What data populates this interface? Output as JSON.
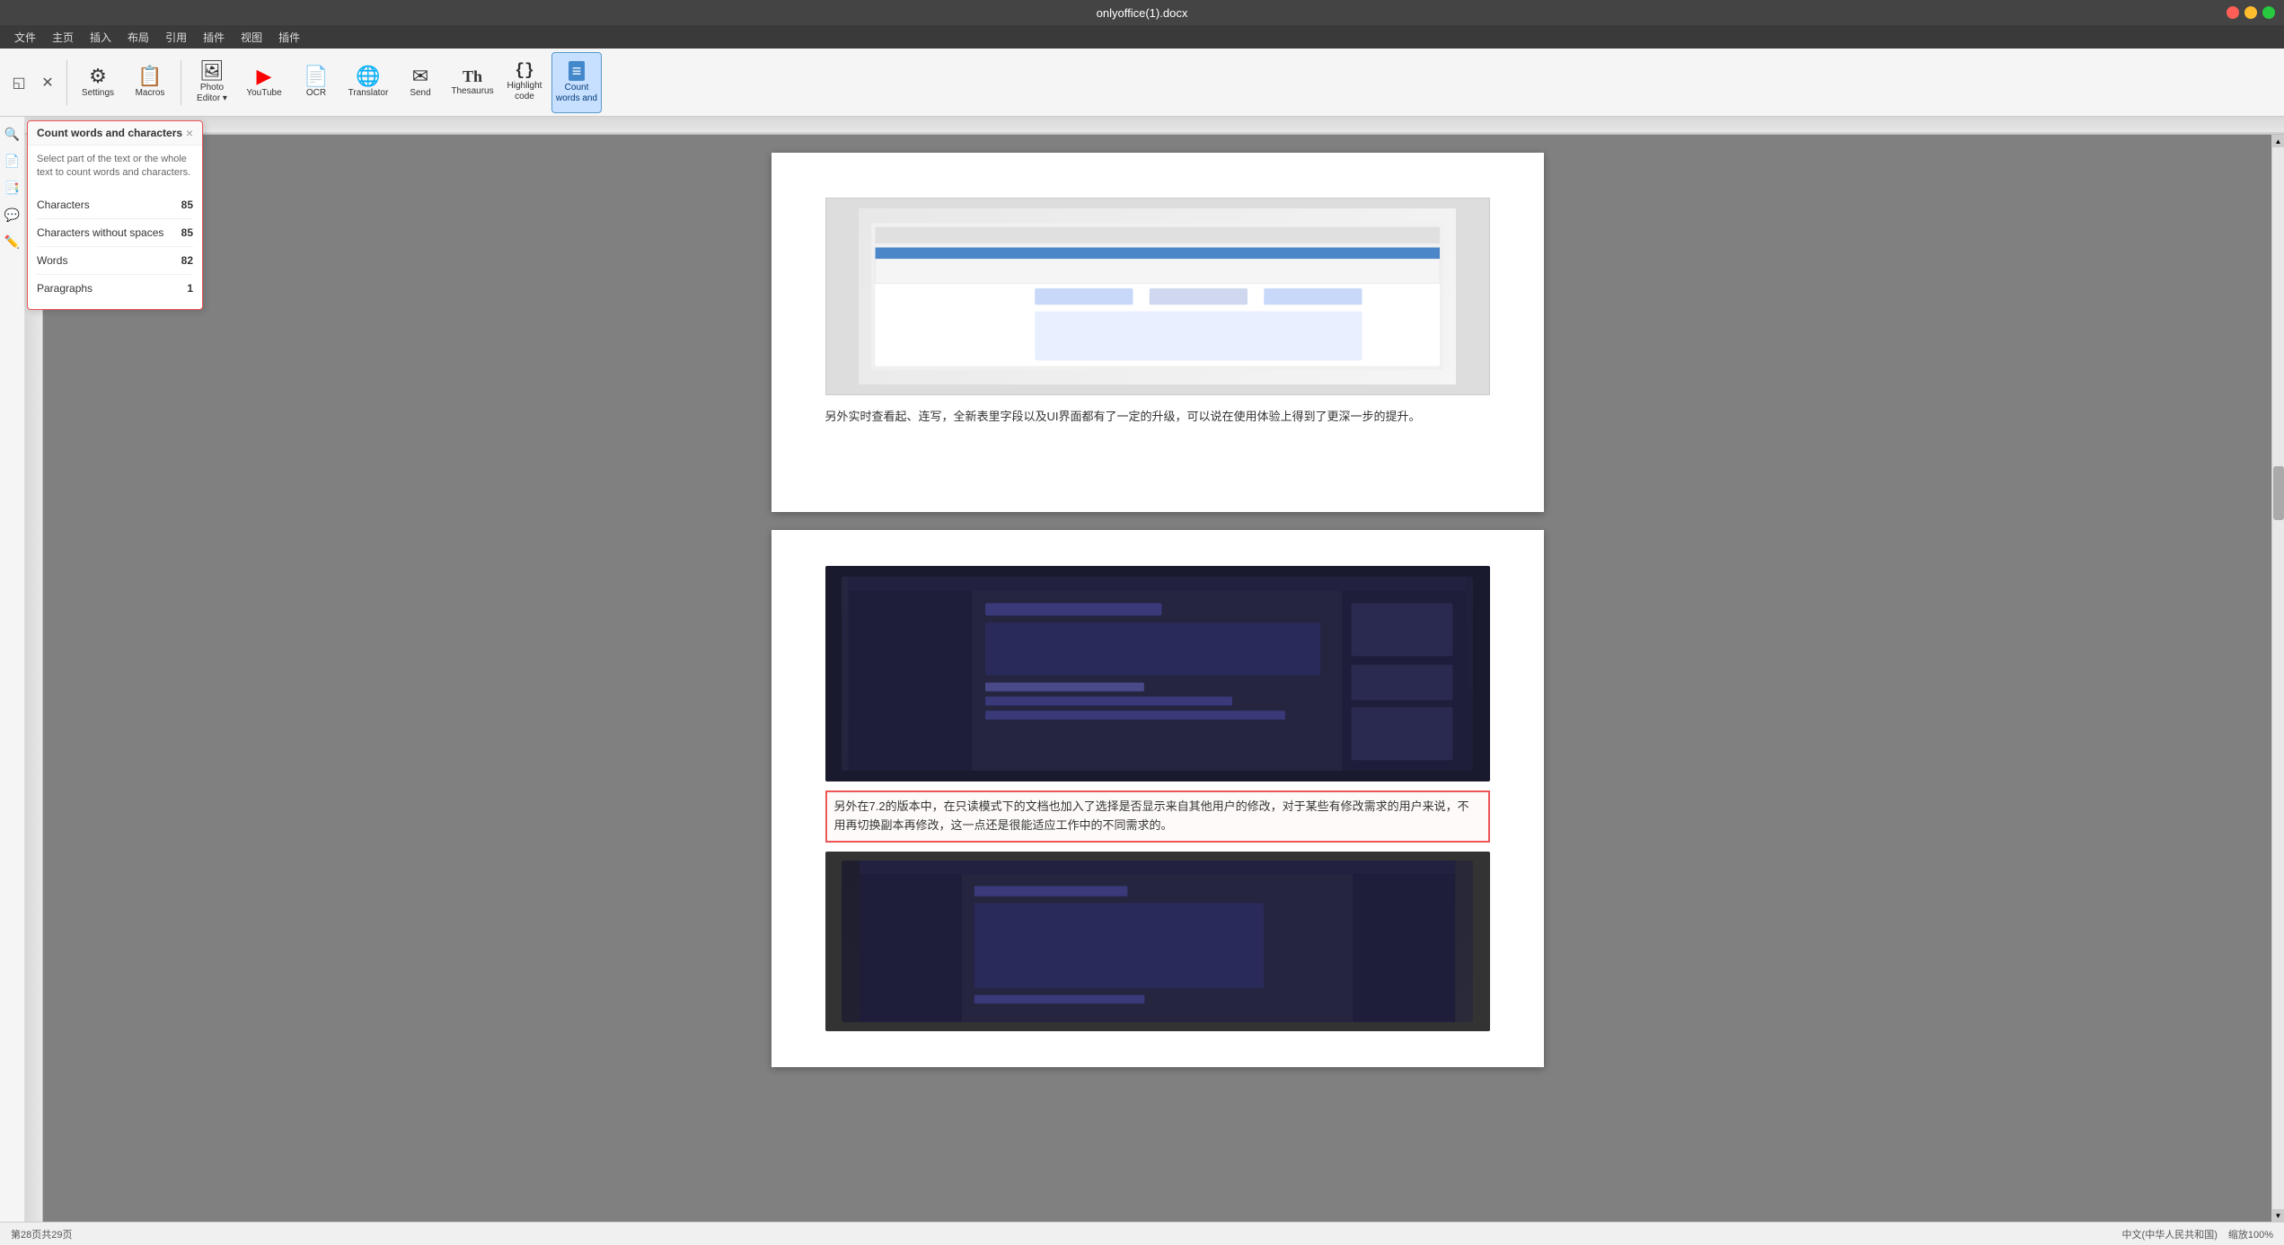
{
  "titleBar": {
    "title": "onlyoffice(1).docx",
    "windowControls": [
      "close",
      "min",
      "max"
    ]
  },
  "menuBar": {
    "items": [
      "文件",
      "主页",
      "插入",
      "布局",
      "引用",
      "插件",
      "视图",
      "插件"
    ]
  },
  "toolbar": {
    "groups": [
      {
        "buttons": [
          {
            "id": "settings",
            "icon": "⚙",
            "label": "Settings"
          },
          {
            "id": "macros",
            "icon": "📋",
            "label": "Macros"
          }
        ]
      },
      {
        "buttons": [
          {
            "id": "photo-editor",
            "icon": "🖼",
            "label": "Photo Editor ▾"
          },
          {
            "id": "youtube",
            "icon": "▶",
            "label": "YouTube",
            "color": "red"
          },
          {
            "id": "ocr",
            "icon": "📄",
            "label": "OCR"
          },
          {
            "id": "translator",
            "icon": "🌐",
            "label": "Translator"
          },
          {
            "id": "send",
            "icon": "✉",
            "label": "Send"
          },
          {
            "id": "thesaurus",
            "icon": "📚",
            "label": "Thesaurus"
          },
          {
            "id": "highlight-code",
            "icon": "{}",
            "label": "Highlight code"
          },
          {
            "id": "count-words",
            "icon": "Ξ",
            "label": "Count words and",
            "active": true
          }
        ]
      }
    ]
  },
  "pluginPanel": {
    "title": "Count words and characters",
    "closeBtn": "×",
    "description": "Select part of the text or the whole text to count words and characters.",
    "stats": [
      {
        "label": "Characters",
        "value": "85"
      },
      {
        "label": "Characters without spaces",
        "value": "85"
      },
      {
        "label": "Words",
        "value": "82"
      },
      {
        "label": "Paragraphs",
        "value": "1"
      }
    ]
  },
  "document": {
    "page1": {
      "paragraphText": "另外实时查看起、连写，全新表里字段以及UI界面都有了一定的升级，可以说在使用体验上得到了更深一步的提升。"
    },
    "page2": {
      "highlightedText": "另外在7.2的版本中，在只读模式下的文档也加入了选择是否显示来自其他用户的修改，对于某些有修改需求的用户来说，不用再切换副本再修改，这一点还是很能适应工作中的不同需求的。"
    },
    "page3": {
      "text": ""
    }
  },
  "statusBar": {
    "left": {
      "pageInfo": "第28页共29页"
    },
    "right": {
      "language": "中文(中华人民共和国)",
      "zoom": "缩放100%"
    }
  },
  "sidebar": {
    "icons": [
      "🔍",
      "📄",
      "📑",
      "💬",
      "✏️"
    ]
  }
}
